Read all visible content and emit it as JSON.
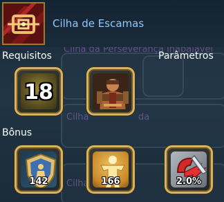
{
  "item": {
    "name": "Cilha de Escamas",
    "icon": "saddle-girth-icon"
  },
  "labels": {
    "requirements": "Requisitos",
    "parameters": "Parâmetros",
    "bonus": "Bônus"
  },
  "background_text": {
    "line1": "Cilha da Perseverança Inabalável",
    "line2": "Cilha",
    "line3": "da",
    "line4": "Cilha"
  },
  "requirements": {
    "level": "18",
    "class_icon": "warrior-portrait-icon"
  },
  "bonus": [
    {
      "icon": "defense-shield-icon",
      "value": "142"
    },
    {
      "icon": "strength-body-icon",
      "value": "166"
    },
    {
      "icon": "critical-damage-icon",
      "value": "2.0%"
    }
  ],
  "colors": {
    "item_name": "#8fc8ff",
    "slot_border": "#d6b363",
    "icon_bg_red": "#6a1414"
  }
}
